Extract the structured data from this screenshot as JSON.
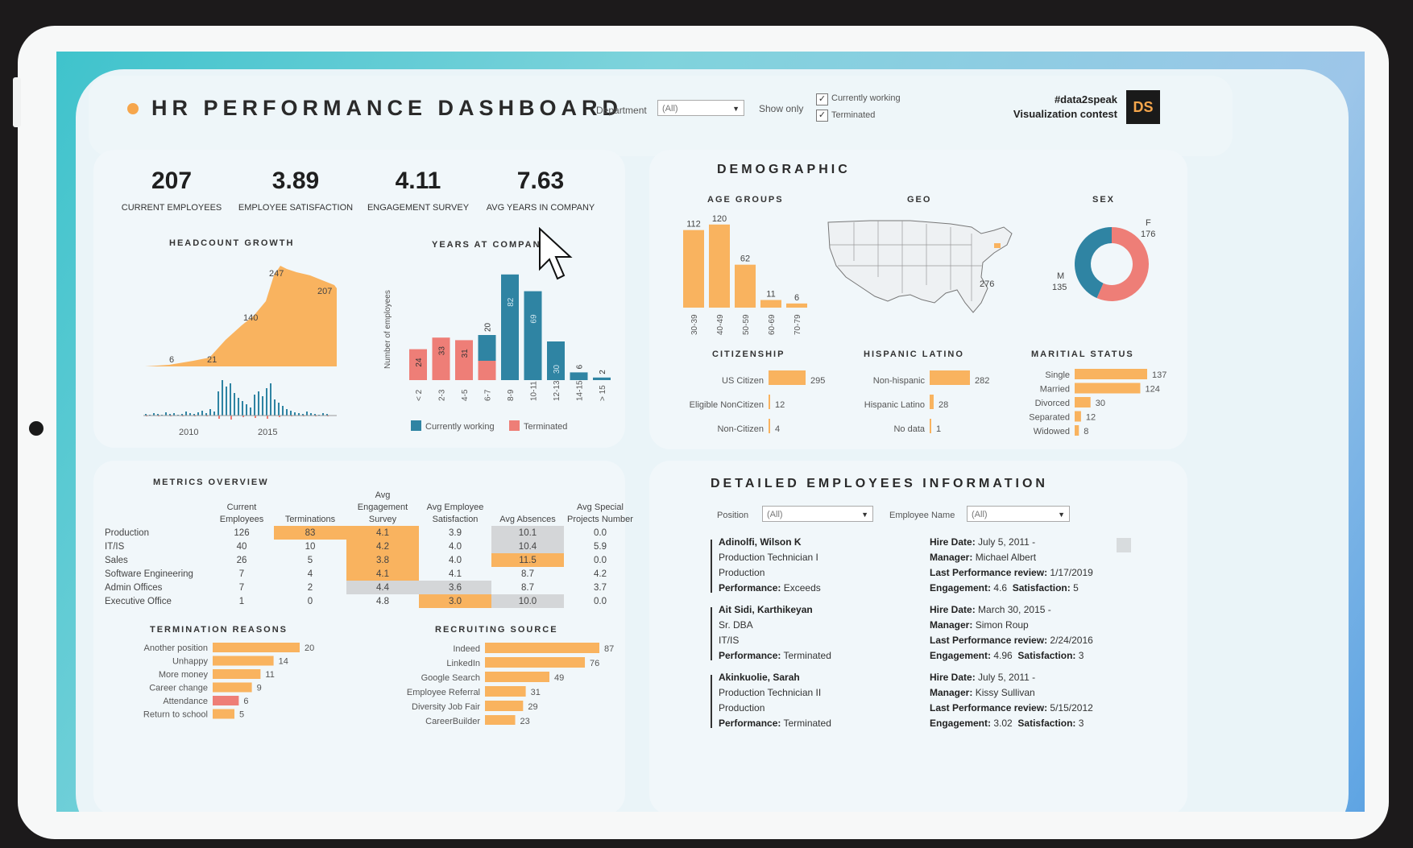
{
  "header": {
    "title": "HR PERFORMANCE DASHBOARD",
    "department_label": "Department",
    "department_value": "(All)",
    "show_only_label": "Show only",
    "filter_currently_working": "Currently working",
    "filter_terminated": "Terminated",
    "contest_line1": "#data2speak",
    "contest_line2": "Visualization contest",
    "logo_text": "DS"
  },
  "kpis": [
    {
      "value": "207",
      "label": "CURRENT EMPLOYEES"
    },
    {
      "value": "3.89",
      "label": "EMPLOYEE SATISFACTION"
    },
    {
      "value": "4.11",
      "label": "ENGAGEMENT SURVEY"
    },
    {
      "value": "7.63",
      "label": "AVG YEARS IN COMPANY"
    }
  ],
  "headcount": {
    "title": "HEADCOUNT GROWTH",
    "annotations": [
      "6",
      "21",
      "140",
      "247",
      "207"
    ],
    "x_ticks": [
      "2010",
      "2015"
    ]
  },
  "years": {
    "title": "YEARS AT COMPANY",
    "ylabel": "Number of employees",
    "legend": [
      "Currently working",
      "Terminated"
    ]
  },
  "demographic": {
    "title": "DEMOGRAPHIC",
    "age_title": "AGE GROUPS",
    "geo_title": "GEO",
    "sex_title": "SEX",
    "geo_value": "276",
    "citizenship_title": "CITIZENSHIP",
    "hispanic_title": "HISPANIC LATINO",
    "marital_title": "MARITIAL STATUS"
  },
  "metrics": {
    "title": "METRICS OVERVIEW",
    "headers": [
      "Current Employees",
      "Terminations",
      "Avg Engagement Survey",
      "Avg Employee Satisfaction",
      "Avg Absences",
      "Avg Special Projects Number"
    ],
    "rows": [
      {
        "name": "Production",
        "v": [
          "126",
          "83",
          "4.1",
          "3.9",
          "10.1",
          "0.0"
        ]
      },
      {
        "name": "IT/IS",
        "v": [
          "40",
          "10",
          "4.2",
          "4.0",
          "10.4",
          "5.9"
        ]
      },
      {
        "name": "Sales",
        "v": [
          "26",
          "5",
          "3.8",
          "4.0",
          "11.5",
          "0.0"
        ]
      },
      {
        "name": "Software Engineering",
        "v": [
          "7",
          "4",
          "4.1",
          "4.1",
          "8.7",
          "4.2"
        ]
      },
      {
        "name": "Admin Offices",
        "v": [
          "7",
          "2",
          "4.4",
          "3.6",
          "8.7",
          "3.7"
        ]
      },
      {
        "name": "Executive Office",
        "v": [
          "1",
          "0",
          "4.8",
          "3.0",
          "10.0",
          "0.0"
        ]
      }
    ]
  },
  "termination": {
    "title": "TERMINATION REASONS"
  },
  "recruiting": {
    "title": "RECRUITING SOURCE"
  },
  "details": {
    "title": "DETAILED EMPLOYEES INFORMATION",
    "position_label": "Position",
    "position_value": "(All)",
    "name_label": "Employee Name",
    "name_value": "(All)",
    "employees": [
      {
        "name": "Adinolfi, Wilson K",
        "position": "Production Technician I",
        "dept": "Production",
        "perf_label": "Performance:",
        "perf": "Exceeds",
        "hire": "July 5, 2011 -",
        "manager": "Michael Albert",
        "review": "1/17/2019",
        "engagement": "4.6",
        "satisfaction": "5"
      },
      {
        "name": "Ait Sidi, Karthikeyan",
        "position": "Sr. DBA",
        "dept": "IT/IS",
        "perf_label": "Performance:",
        "perf": "Terminated",
        "hire": "March 30, 2015 -",
        "manager": "Simon Roup",
        "review": "2/24/2016",
        "engagement": "4.96",
        "satisfaction": "3"
      },
      {
        "name": "Akinkuolie, Sarah",
        "position": "Production Technician II",
        "dept": "Production",
        "perf_label": "Performance:",
        "perf": "Terminated",
        "hire": "July 5, 2011 -",
        "manager": "Kissy Sullivan",
        "review": "5/15/2012",
        "engagement": "3.02",
        "satisfaction": "3"
      }
    ],
    "labels": {
      "hire": "Hire Date:",
      "manager": "Manager:",
      "review": "Last Performance review:",
      "engagement": "Engagement:",
      "satisfaction": "Satisfaction:"
    }
  },
  "colors": {
    "orange": "#f9b35f",
    "teal": "#2f84a3",
    "salmon": "#ee7e77",
    "grey": "#d4d6d8"
  },
  "chart_data": [
    {
      "type": "area",
      "title": "HEADCOUNT GROWTH",
      "x_ticks": [
        "2010",
        "2015"
      ],
      "annotations": [
        6,
        21,
        140,
        247,
        207
      ]
    },
    {
      "type": "bar",
      "title": "YEARS AT COMPANY",
      "ylabel": "Number of employees",
      "categories": [
        "< 2",
        "2-3",
        "4-5",
        "6-7",
        "8-9",
        "10-11",
        "12-13",
        "14-15",
        "> 15"
      ],
      "series": [
        {
          "name": "Currently working",
          "values": [
            0,
            0,
            0,
            20,
            82,
            69,
            30,
            6,
            2
          ]
        },
        {
          "name": "Terminated",
          "values": [
            24,
            33,
            31,
            15,
            0,
            0,
            0,
            0,
            0
          ]
        }
      ]
    },
    {
      "type": "bar",
      "title": "AGE GROUPS",
      "categories": [
        "30-39",
        "40-49",
        "50-59",
        "60-69",
        "70-79"
      ],
      "values": [
        112,
        120,
        62,
        11,
        6
      ]
    },
    {
      "type": "pie",
      "title": "SEX",
      "categories": [
        "F",
        "M"
      ],
      "values": [
        176,
        135
      ]
    },
    {
      "type": "bar",
      "title": "CITIZENSHIP",
      "categories": [
        "US Citizen",
        "Eligible NonCitizen",
        "Non-Citizen"
      ],
      "values": [
        295,
        12,
        4
      ]
    },
    {
      "type": "bar",
      "title": "HISPANIC LATINO",
      "categories": [
        "Non-hispanic",
        "Hispanic Latino",
        "No data"
      ],
      "values": [
        282,
        28,
        1
      ]
    },
    {
      "type": "bar",
      "title": "MARITIAL STATUS",
      "categories": [
        "Single",
        "Married",
        "Divorced",
        "Separated",
        "Widowed"
      ],
      "values": [
        137,
        124,
        30,
        12,
        8
      ]
    },
    {
      "type": "bar",
      "title": "TERMINATION REASONS",
      "categories": [
        "Another position",
        "Unhappy",
        "More money",
        "Career change",
        "Attendance",
        "Return to school"
      ],
      "values": [
        20,
        14,
        11,
        9,
        6,
        5
      ]
    },
    {
      "type": "bar",
      "title": "RECRUITING SOURCE",
      "categories": [
        "Indeed",
        "LinkedIn",
        "Google Search",
        "Employee Referral",
        "Diversity Job Fair",
        "CareerBuilder"
      ],
      "values": [
        87,
        76,
        49,
        31,
        29,
        23
      ]
    }
  ]
}
